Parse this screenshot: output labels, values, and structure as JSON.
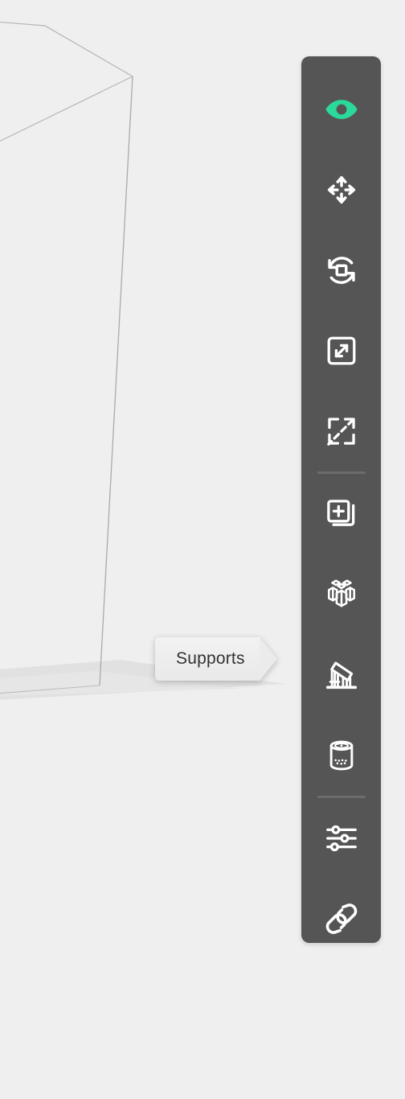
{
  "app": {
    "background_color": "#efefef",
    "viewport_name": "3d-print-build-plate-viewport"
  },
  "viewport": {
    "build_plate_label": "build-plate-wireframe",
    "line_color": "#b0b0b0",
    "shadow_color": "#dcdcdc"
  },
  "tooltip": {
    "label": "Supports",
    "background_color": "#ebebeb",
    "text_color": "#333333"
  },
  "toolbar": {
    "background_color": "#555555",
    "active_color": "#2bd99a",
    "icon_color": "#ffffff",
    "items": [
      {
        "name": "visibility-eye-icon",
        "label": "Preview",
        "active": true
      },
      {
        "name": "move-arrows-icon",
        "label": "Move",
        "active": false
      },
      {
        "name": "rotate-icon",
        "label": "Rotate",
        "active": false
      },
      {
        "name": "scale-icon",
        "label": "Scale",
        "active": false
      },
      {
        "name": "mirror-cut-icon",
        "label": "Mirror",
        "active": false
      },
      {
        "name": "duplicate-add-icon",
        "label": "Duplicate",
        "active": false
      },
      {
        "name": "arrange-pack-icon",
        "label": "Magic Arrange",
        "active": false
      },
      {
        "name": "supports-icon",
        "label": "Supports",
        "active": false
      },
      {
        "name": "hollow-infill-icon",
        "label": "Hollow",
        "active": false
      },
      {
        "name": "sliders-settings-icon",
        "label": "Settings",
        "active": false
      },
      {
        "name": "link-chain-icon",
        "label": "Link",
        "active": false
      }
    ],
    "dividers": [
      {
        "after_index": 4
      },
      {
        "after_index": 8
      }
    ]
  }
}
